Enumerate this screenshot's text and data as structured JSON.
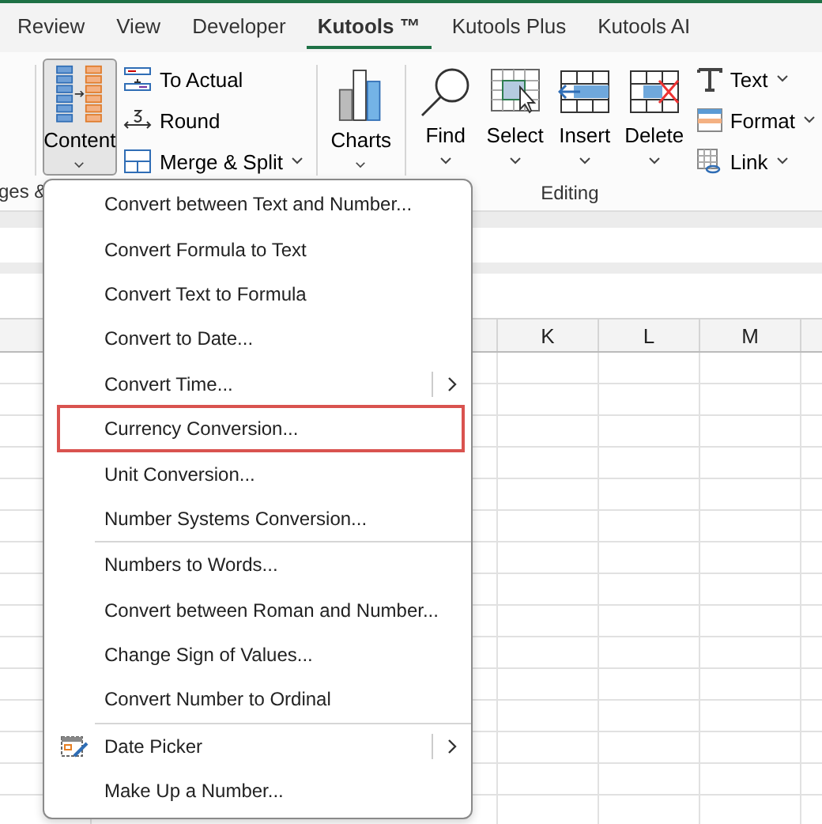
{
  "tabs": [
    {
      "label": "Review",
      "selected": false
    },
    {
      "label": "View",
      "selected": false
    },
    {
      "label": "Developer",
      "selected": false
    },
    {
      "label": "Kutools ™",
      "selected": true
    },
    {
      "label": "Kutools Plus",
      "selected": false
    },
    {
      "label": "Kutools AI",
      "selected": false
    }
  ],
  "ribbon": {
    "left_group_label": "ges &",
    "content_button": {
      "label": "Content",
      "pressed": true
    },
    "small_buttons": [
      {
        "label": "To Actual",
        "kind": "to-actual",
        "dropdown": false
      },
      {
        "label": "Round",
        "kind": "round",
        "dropdown": false
      },
      {
        "label": "Merge & Split",
        "kind": "merge",
        "dropdown": true
      }
    ],
    "charts_button": {
      "label": "Charts"
    },
    "editing_buttons": [
      {
        "label": "Find",
        "kind": "find"
      },
      {
        "label": "Select",
        "kind": "select"
      },
      {
        "label": "Insert",
        "kind": "insert"
      },
      {
        "label": "Delete",
        "kind": "delete"
      }
    ],
    "text_buttons": [
      {
        "label": "Text",
        "kind": "text"
      },
      {
        "label": "Format",
        "kind": "format"
      },
      {
        "label": "Link",
        "kind": "link"
      }
    ],
    "editing_label": "Editing"
  },
  "sheet": {
    "columns": [
      "K",
      "L",
      "M"
    ]
  },
  "menu": {
    "items": [
      {
        "kind": "item",
        "label": "Convert between Text and Number...",
        "submenu": false,
        "highlighted": false,
        "icon": false
      },
      {
        "kind": "item",
        "label": "Convert Formula to Text",
        "submenu": false,
        "highlighted": false,
        "icon": false
      },
      {
        "kind": "item",
        "label": "Convert Text to Formula",
        "submenu": false,
        "highlighted": false,
        "icon": false
      },
      {
        "kind": "item",
        "label": "Convert to Date...",
        "submenu": false,
        "highlighted": false,
        "icon": false
      },
      {
        "kind": "item",
        "label": "Convert Time...",
        "submenu": true,
        "highlighted": false,
        "icon": false
      },
      {
        "kind": "item",
        "label": "Currency Conversion...",
        "submenu": false,
        "highlighted": true,
        "icon": false
      },
      {
        "kind": "item",
        "label": "Unit Conversion...",
        "submenu": false,
        "highlighted": false,
        "icon": false
      },
      {
        "kind": "item",
        "label": "Number Systems Conversion...",
        "submenu": false,
        "highlighted": false,
        "icon": false
      },
      {
        "kind": "separator"
      },
      {
        "kind": "item",
        "label": "Numbers to Words...",
        "submenu": false,
        "highlighted": false,
        "icon": false
      },
      {
        "kind": "item",
        "label": "Convert between Roman and Number...",
        "submenu": false,
        "highlighted": false,
        "icon": false
      },
      {
        "kind": "item",
        "label": "Change Sign of Values...",
        "submenu": false,
        "highlighted": false,
        "icon": false
      },
      {
        "kind": "item",
        "label": "Convert Number to Ordinal",
        "submenu": false,
        "highlighted": false,
        "icon": false
      },
      {
        "kind": "separator"
      },
      {
        "kind": "item",
        "label": "Date Picker",
        "submenu": true,
        "highlighted": false,
        "icon": true
      },
      {
        "kind": "item",
        "label": "Make Up a Number...",
        "submenu": false,
        "highlighted": false,
        "icon": false
      }
    ]
  }
}
